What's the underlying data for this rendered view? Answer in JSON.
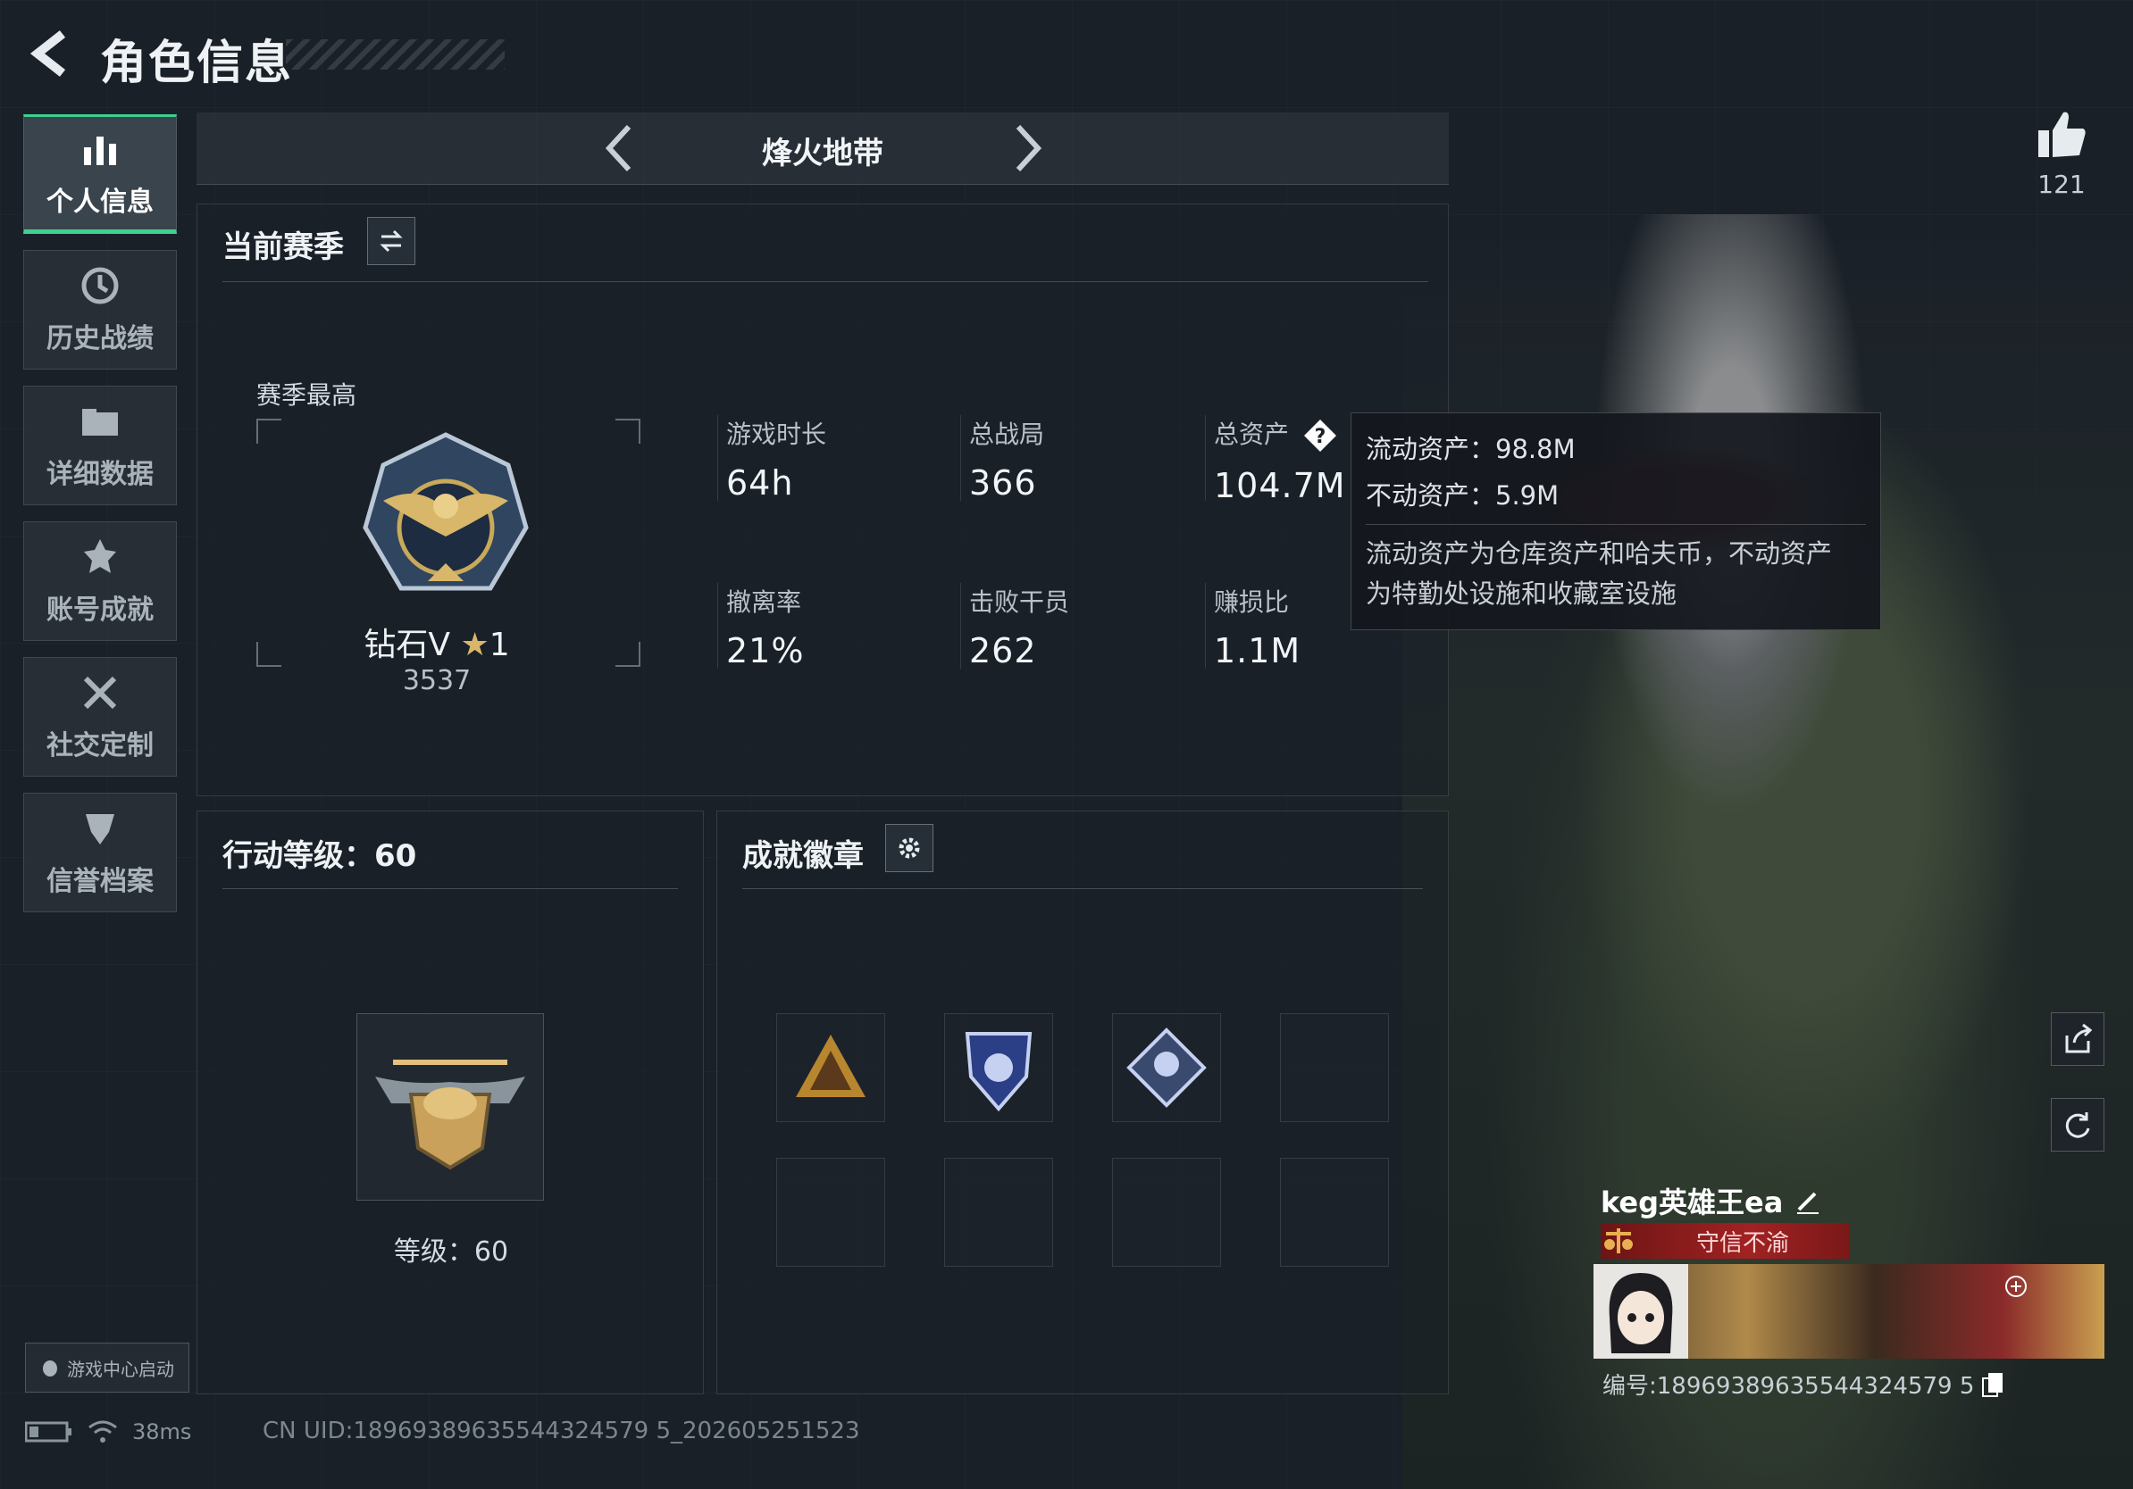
{
  "header": {
    "title": "角色信息"
  },
  "sidebar": {
    "items": [
      {
        "label": "个人信息",
        "icon": "bar-chart-icon",
        "active": true
      },
      {
        "label": "历史战绩",
        "icon": "history-icon",
        "active": false
      },
      {
        "label": "详细数据",
        "icon": "folder-icon",
        "active": false
      },
      {
        "label": "账号成就",
        "icon": "achievement-icon",
        "active": false
      },
      {
        "label": "社交定制",
        "icon": "tools-icon",
        "active": false
      },
      {
        "label": "信誉档案",
        "icon": "shield-icon",
        "active": false
      }
    ],
    "game_center_label": "游戏中心启动"
  },
  "mode": {
    "title": "烽火地带"
  },
  "season_panel": {
    "title": "当前赛季",
    "peak_label": "赛季最高",
    "rank_name": "钻石V",
    "rank_stars": "1",
    "rank_score": "3537",
    "stats": [
      {
        "label": "游戏时长",
        "value": "64h"
      },
      {
        "label": "总战局",
        "value": "366"
      },
      {
        "label": "总资产",
        "value": "104.7M"
      },
      {
        "label": "撤离率",
        "value": "21%"
      },
      {
        "label": "击败干员",
        "value": "262"
      },
      {
        "label": "赚损比",
        "value": "1.1M"
      }
    ]
  },
  "tooltip": {
    "liquid": "流动资产：98.8M",
    "fixed": "不动资产：5.9M",
    "desc_line1": "流动资产为仓库资产和哈夫币，不动资产",
    "desc_line2": "为特勤处设施和收藏室设施"
  },
  "level_panel": {
    "title": "行动等级：60",
    "level_label": "等级：60"
  },
  "badge_panel": {
    "title": "成就徽章"
  },
  "like": {
    "count": "121"
  },
  "player": {
    "name": "keg英雄王ea",
    "title": "守信不渝",
    "id_text": "编号:18969389635544324579 5"
  },
  "status": {
    "ping": "38ms",
    "uid": "CN UID:18969389635544324579 5_202605251523"
  },
  "colors": {
    "accent": "#3fd18e",
    "title_red": "#a12222"
  }
}
